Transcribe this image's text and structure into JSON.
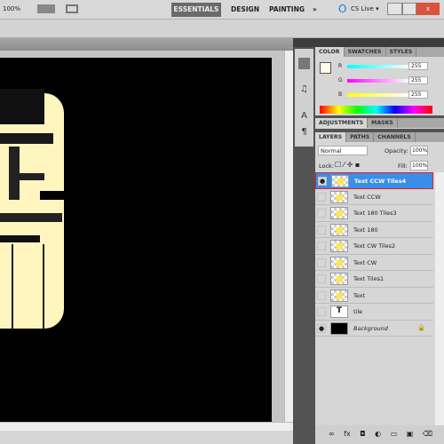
{
  "app_bar": {
    "zoom": "100%",
    "workspaces": [
      "ESSENTIALS",
      "DESIGN",
      "PAINTING"
    ],
    "more": "»",
    "cs_live": "CS Live ▾",
    "active_workspace": "ESSENTIALS"
  },
  "color_panel": {
    "tabs": [
      "COLOR",
      "SWATCHES",
      "STYLES"
    ],
    "channels": [
      {
        "label": "R",
        "value": "255"
      },
      {
        "label": "G",
        "value": "255"
      },
      {
        "label": "B",
        "value": "255"
      }
    ]
  },
  "adjust_panel": {
    "tabs": [
      "ADJUSTMENTS",
      "MASKS"
    ]
  },
  "layers_panel": {
    "tabs": [
      "LAYERS",
      "PATHS",
      "CHANNELS"
    ],
    "blend_mode": "Normal",
    "opacity_label": "Opacity:",
    "opacity": "100%",
    "lock_label": "Lock:",
    "fill_label": "Fill:",
    "fill": "100%",
    "layers": [
      {
        "name": "Text CCW Tiles4",
        "visible": true,
        "selected": true,
        "thumb": "transparent"
      },
      {
        "name": "Text CCW",
        "visible": false,
        "thumb": "transparent"
      },
      {
        "name": "Text 180 Tiles3",
        "visible": false,
        "thumb": "transparent"
      },
      {
        "name": "Text 180",
        "visible": false,
        "thumb": "transparent"
      },
      {
        "name": "Text CW Tiles2",
        "visible": false,
        "thumb": "transparent"
      },
      {
        "name": "Text CW",
        "visible": false,
        "thumb": "transparent"
      },
      {
        "name": "Text Tiles1",
        "visible": false,
        "thumb": "transparent"
      },
      {
        "name": "Text",
        "visible": false,
        "thumb": "transparent"
      },
      {
        "name": "tile",
        "visible": false,
        "thumb": "type"
      },
      {
        "name": "Background",
        "visible": true,
        "thumb": "black",
        "locked": true
      }
    ]
  },
  "colors": {
    "canvas": "#000000",
    "tile": "#fff5bf",
    "selection": "#3a8ee8",
    "highlight_border": "#e0202a"
  }
}
